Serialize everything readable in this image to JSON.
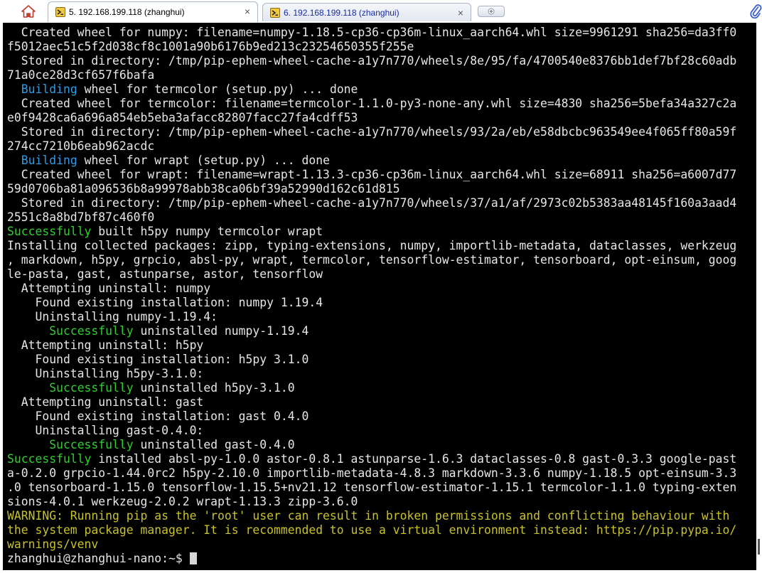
{
  "tabs": [
    {
      "label": "5. 192.168.199.118 (zhanghui)",
      "active": true,
      "close": "×"
    },
    {
      "label": "6. 192.168.199.118 (zhanghui)",
      "active": false,
      "close": "×"
    }
  ],
  "icons": {
    "home": "home-icon",
    "tab": "terminal-icon",
    "new_tab": "plus-icon",
    "attach": "paperclip-icon"
  },
  "colors": {
    "terminal_bg": "#000000",
    "text": "#e6e6e6",
    "green": "#2fcf2f",
    "blue": "#2c9ce8",
    "yellow": "#c8c12a"
  },
  "terminal": {
    "lines": [
      [
        {
          "t": "  Created wheel for numpy: filename=numpy-1.18.5-cp36-cp36m-linux_aarch64.whl size=9961291 sha256=da3ff0"
        }
      ],
      [
        {
          "t": "f5012aec51c5f2d038cf8c1001a90b6176b9ed213c23254650355f255e"
        }
      ],
      [
        {
          "t": "  Stored in directory: /tmp/pip-ephem-wheel-cache-a1y7n770/wheels/8e/95/fa/4700540e8376bb1def7bf28c60adb"
        }
      ],
      [
        {
          "t": "71a0ce28d3cf657f6bafa"
        }
      ],
      [
        {
          "t": "  "
        },
        {
          "t": "Building",
          "c": "blue"
        },
        {
          "t": " wheel for termcolor (setup.py) ... done"
        }
      ],
      [
        {
          "t": "  Created wheel for termcolor: filename=termcolor-1.1.0-py3-none-any.whl size=4830 sha256=5befa34a327c2a"
        }
      ],
      [
        {
          "t": "e0f9428ca6a696a854eb5eba3afacc82807facc27fa4cdff53"
        }
      ],
      [
        {
          "t": "  Stored in directory: /tmp/pip-ephem-wheel-cache-a1y7n770/wheels/93/2a/eb/e58dbcbc963549ee4f065ff80a59f"
        }
      ],
      [
        {
          "t": "274cc7210b6eab962acdc"
        }
      ],
      [
        {
          "t": "  "
        },
        {
          "t": "Building",
          "c": "blue"
        },
        {
          "t": " wheel for wrapt (setup.py) ... done"
        }
      ],
      [
        {
          "t": "  Created wheel for wrapt: filename=wrapt-1.13.3-cp36-cp36m-linux_aarch64.whl size=68911 sha256=a6007d77"
        }
      ],
      [
        {
          "t": "59d0706ba81a096536b8a99978abb38ca06bf39a52990d162c61d815"
        }
      ],
      [
        {
          "t": "  Stored in directory: /tmp/pip-ephem-wheel-cache-a1y7n770/wheels/37/a1/af/2973c02b5383aa48145f160a3aad4"
        }
      ],
      [
        {
          "t": "2551c8a8bd7bf87c460f0"
        }
      ],
      [
        {
          "t": "Successfully",
          "c": "green"
        },
        {
          "t": " built h5py numpy termcolor wrapt"
        }
      ],
      [
        {
          "t": "Installing collected packages: zipp, typing-extensions, numpy, importlib-metadata, dataclasses, werkzeug"
        }
      ],
      [
        {
          "t": ", markdown, h5py, grpcio, absl-py, wrapt, termcolor, tensorflow-estimator, tensorboard, opt-einsum, goog"
        }
      ],
      [
        {
          "t": "le-pasta, gast, astunparse, astor, tensorflow"
        }
      ],
      [
        {
          "t": "  Attempting uninstall: numpy"
        }
      ],
      [
        {
          "t": "    Found existing installation: numpy 1.19.4"
        }
      ],
      [
        {
          "t": "    Uninstalling numpy-1.19.4:"
        }
      ],
      [
        {
          "t": "      "
        },
        {
          "t": "Successfully",
          "c": "green"
        },
        {
          "t": " uninstalled numpy-1.19.4"
        }
      ],
      [
        {
          "t": "  Attempting uninstall: h5py"
        }
      ],
      [
        {
          "t": "    Found existing installation: h5py 3.1.0"
        }
      ],
      [
        {
          "t": "    Uninstalling h5py-3.1.0:"
        }
      ],
      [
        {
          "t": "      "
        },
        {
          "t": "Successfully",
          "c": "green"
        },
        {
          "t": " uninstalled h5py-3.1.0"
        }
      ],
      [
        {
          "t": "  Attempting uninstall: gast"
        }
      ],
      [
        {
          "t": "    Found existing installation: gast 0.4.0"
        }
      ],
      [
        {
          "t": "    Uninstalling gast-0.4.0:"
        }
      ],
      [
        {
          "t": "      "
        },
        {
          "t": "Successfully",
          "c": "green"
        },
        {
          "t": " uninstalled gast-0.4.0"
        }
      ],
      [
        {
          "t": "Successfully",
          "c": "green"
        },
        {
          "t": " installed absl-py-1.0.0 astor-0.8.1 astunparse-1.6.3 dataclasses-0.8 gast-0.3.3 google-past"
        }
      ],
      [
        {
          "t": "a-0.2.0 grpcio-1.44.0rc2 h5py-2.10.0 importlib-metadata-4.8.3 markdown-3.3.6 numpy-1.18.5 opt-einsum-3.3"
        }
      ],
      [
        {
          "t": ".0 tensorboard-1.15.0 tensorflow-1.15.5+nv21.12 tensorflow-estimator-1.15.1 termcolor-1.1.0 typing-exten"
        }
      ],
      [
        {
          "t": "sions-4.0.1 werkzeug-2.0.2 wrapt-1.13.3 zipp-3.6.0"
        }
      ],
      [
        {
          "t": "WARNING: Running pip as the 'root' user can result in broken permissions and conflicting behaviour with",
          "c": "yellow"
        }
      ],
      [
        {
          "t": "the system package manager. It is recommended to use a virtual environment instead: https://pip.pypa.io/",
          "c": "yellow"
        }
      ],
      [
        {
          "t": "warnings/venv",
          "c": "yellow"
        }
      ]
    ],
    "prompt": "zhanghui@zhanghui-nano:~$ "
  }
}
